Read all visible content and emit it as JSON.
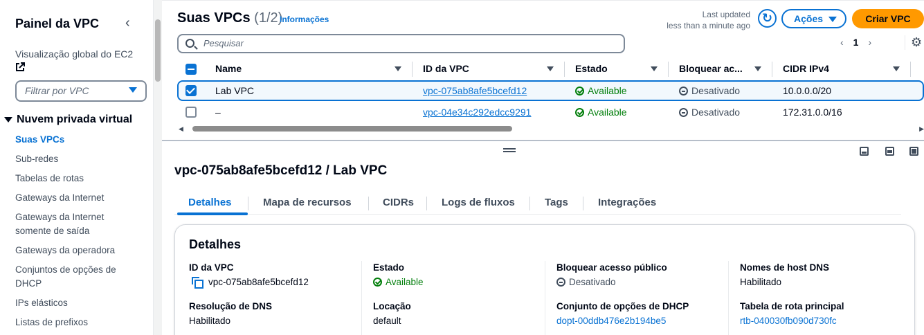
{
  "sidebar": {
    "title": "Painel da VPC",
    "global_view": "Visualização global do EC2",
    "filter_placeholder": "Filtrar por VPC",
    "section": "Nuvem privada virtual",
    "items": [
      {
        "label": "Suas VPCs"
      },
      {
        "label": "Sub-redes"
      },
      {
        "label": "Tabelas de rotas"
      },
      {
        "label": "Gateways da Internet"
      },
      {
        "label": "Gateways da Internet somente de saída"
      },
      {
        "label": "Gateways da operadora"
      },
      {
        "label": "Conjuntos de opções de DHCP"
      },
      {
        "label": "IPs elásticos"
      },
      {
        "label": "Listas de prefixos"
      }
    ]
  },
  "table_panel": {
    "title": "Suas VPCs",
    "count": "(1/2)",
    "info": "Informações",
    "last_updated_line1": "Last updated",
    "last_updated_line2": "less than a minute ago",
    "actions_label": "Ações",
    "create_label": "Criar VPC",
    "search_placeholder": "Pesquisar",
    "page": "1",
    "columns": [
      "Name",
      "ID da VPC",
      "Estado",
      "Bloquear ac...",
      "CIDR IPv4"
    ],
    "rows": [
      {
        "name": "Lab VPC",
        "vpc_id": "vpc-075ab8afe5bcefd12",
        "state": "Available",
        "block": "Desativado",
        "cidr": "10.0.0.0/20",
        "selected": true
      },
      {
        "name": "–",
        "vpc_id": "vpc-04e34c292edcc9291",
        "state": "Available",
        "block": "Desativado",
        "cidr": "172.31.0.0/16",
        "selected": false
      }
    ]
  },
  "detail": {
    "title": "vpc-075ab8afe5bcefd12 / Lab VPC",
    "tabs": [
      "Detalhes",
      "Mapa de recursos",
      "CIDRs",
      "Logs de fluxos",
      "Tags",
      "Integrações"
    ],
    "card_title": "Detalhes",
    "fields": {
      "vpc_id_label": "ID da VPC",
      "vpc_id_value": "vpc-075ab8afe5bcefd12",
      "state_label": "Estado",
      "state_value": "Available",
      "block_label": "Bloquear acesso público",
      "block_value": "Desativado",
      "dns_host_label": "Nomes de host DNS",
      "dns_host_value": "Habilitado",
      "dns_res_label": "Resolução de DNS",
      "dns_res_value": "Habilitado",
      "location_label": "Locação",
      "location_value": "default",
      "dhcp_label": "Conjunto de opções de DHCP",
      "dhcp_value": "dopt-00ddb476e2b194be5",
      "route_label": "Tabela de rota principal",
      "route_value": "rtb-040030fb090d730fc"
    }
  },
  "colors": {
    "accent": "#0972d3",
    "primary_button": "#ff9900",
    "success": "#037f0c",
    "text": "#000716"
  }
}
